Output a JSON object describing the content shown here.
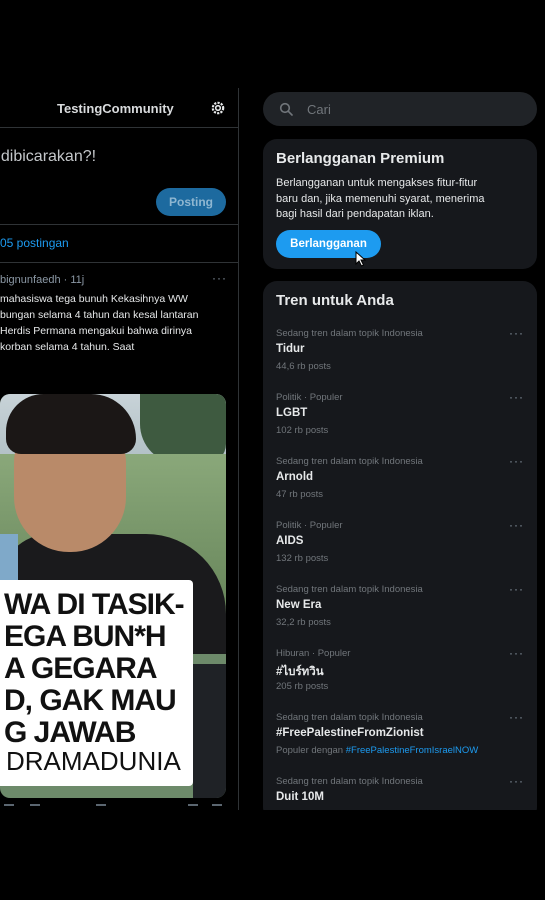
{
  "community": {
    "name": "TestingCommunity",
    "compose_prompt": "t dibicarakan?!",
    "post_button": "Posting",
    "post_count": "05 postingan"
  },
  "post": {
    "author": "bignunfaedh · 11j",
    "more": "···",
    "text_lines": [
      "mahasiswa tega bunuh Kekasihnya WW",
      "bungan selama 4 tahun dan kesal lantaran",
      "Herdis Permana mengakui bahwa dirinya",
      "korban selama 4 tahun. Saat"
    ],
    "image_caption_lines": [
      "WA DI TASIK-",
      "EGA BUN*H",
      "A GEGARA",
      "D, GAK MAU",
      "G JAWAB"
    ],
    "image_caption_tag": "DRAMADUNIA"
  },
  "search": {
    "placeholder": "Cari"
  },
  "premium": {
    "title": "Berlangganan Premium",
    "desc_lines": [
      "Berlangganan untuk mengakses fitur-fitur",
      "baru dan, jika memenuhi syarat, menerima",
      "bagi hasil dari pendapatan iklan."
    ],
    "button": "Berlangganan"
  },
  "trends": {
    "title": "Tren untuk Anda",
    "more": "···",
    "items": [
      {
        "meta": "Sedang tren dalam topik Indonesia",
        "name": "Tidur",
        "count": "44,6 rb posts"
      },
      {
        "meta": "Politik · Populer",
        "name": "LGBT",
        "count": "102 rb posts"
      },
      {
        "meta": "Sedang tren dalam topik Indonesia",
        "name": "Arnold",
        "count": "47 rb posts"
      },
      {
        "meta": "Politik · Populer",
        "name": "AIDS",
        "count": "132 rb posts"
      },
      {
        "meta": "Sedang tren dalam topik Indonesia",
        "name": "New Era",
        "count": "32,2 rb posts"
      },
      {
        "meta": "Hiburan · Populer",
        "name": "#ไบร์ทวิน",
        "count": "205 rb posts"
      },
      {
        "meta": "Sedang tren dalam topik Indonesia",
        "name": "#FreePalestineFromZionist",
        "count_prefix": "Populer dengan",
        "count_link": "#FreePalestineFromIsraelNOW"
      },
      {
        "meta": "Sedang tren dalam topik Indonesia",
        "name": "Duit 10M"
      }
    ]
  }
}
